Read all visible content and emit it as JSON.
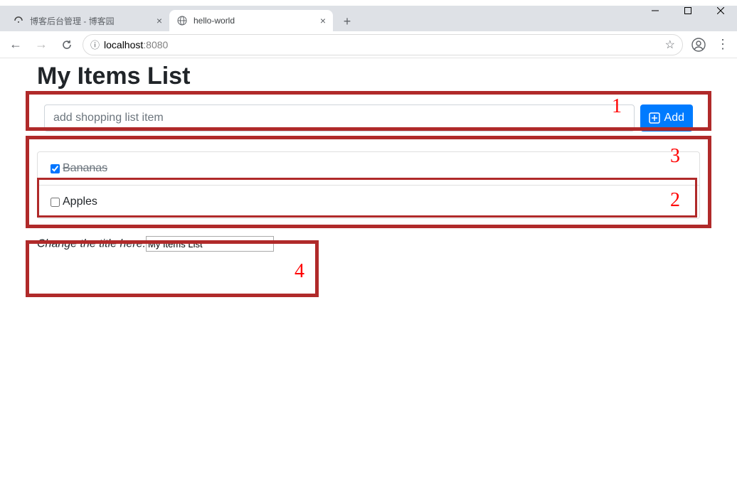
{
  "window": {
    "minimize_icon": "minimize",
    "maximize_icon": "maximize",
    "close_icon": "close"
  },
  "tabs": [
    {
      "title": "博客后台管理 - 博客园",
      "active": false
    },
    {
      "title": "hello-world",
      "active": true
    }
  ],
  "addressbar": {
    "host": "localhost",
    "port": ":8080"
  },
  "page": {
    "heading": "My Items List",
    "input_placeholder": "add shopping list item",
    "add_label": "Add",
    "items": [
      {
        "text": "Bananas",
        "checked": true
      },
      {
        "text": "Apples",
        "checked": false
      }
    ],
    "title_change_label": "Change the title here:",
    "title_input_value": "My Items List"
  },
  "annotations": {
    "n1": "1",
    "n2": "2",
    "n3": "3",
    "n4": "4"
  }
}
